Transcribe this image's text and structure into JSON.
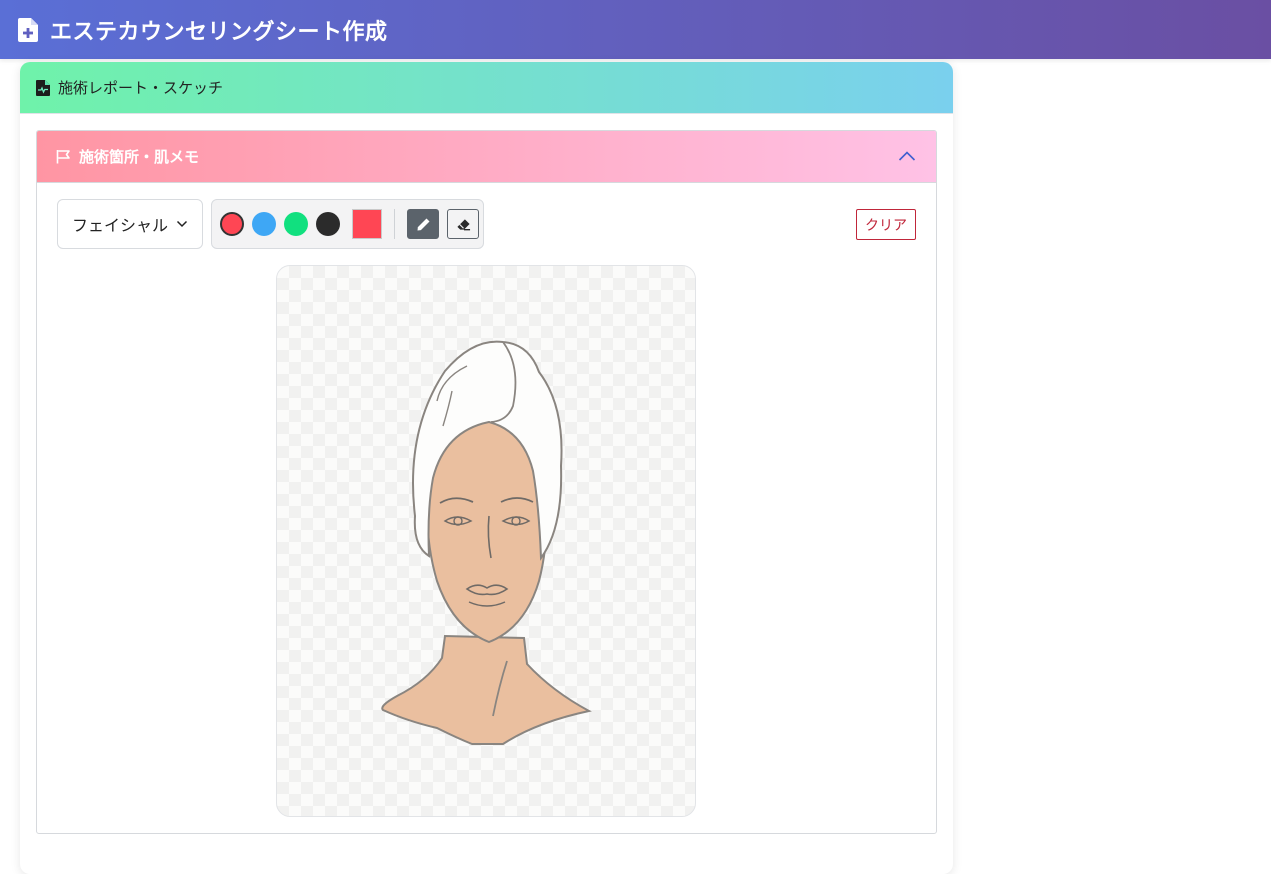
{
  "header": {
    "title": "エステカウンセリングシート作成"
  },
  "section": {
    "title": "施術レポート・スケッチ"
  },
  "panel": {
    "title": "施術箇所・肌メモ"
  },
  "toolbar": {
    "body_part_select": "フェイシャル",
    "palette": [
      {
        "name": "red",
        "color": "#ff4654",
        "selected": true
      },
      {
        "name": "blue",
        "color": "#3ea7f5",
        "selected": false
      },
      {
        "name": "green",
        "color": "#11e07f",
        "selected": false
      },
      {
        "name": "black",
        "color": "#2b2b2b",
        "selected": false
      }
    ],
    "current_color": "#ff4654",
    "active_tool": "pen",
    "clear_label": "クリア"
  },
  "icons": {
    "header": "file-plus-icon",
    "section": "file-medical-icon",
    "panel": "flag-icon",
    "collapse": "chevron-up-icon",
    "pen": "pencil-icon",
    "eraser": "eraser-icon"
  },
  "colors": {
    "header_gradient": [
      "#5a6fd6",
      "#6a4fa3"
    ],
    "section_gradient": [
      "#6ff2aa",
      "#7ad0ee"
    ],
    "panel_gradient": [
      "#ff95a3",
      "#ffc2e6"
    ],
    "skin": "#eabf9f",
    "clear_accent": "#c0263a"
  }
}
